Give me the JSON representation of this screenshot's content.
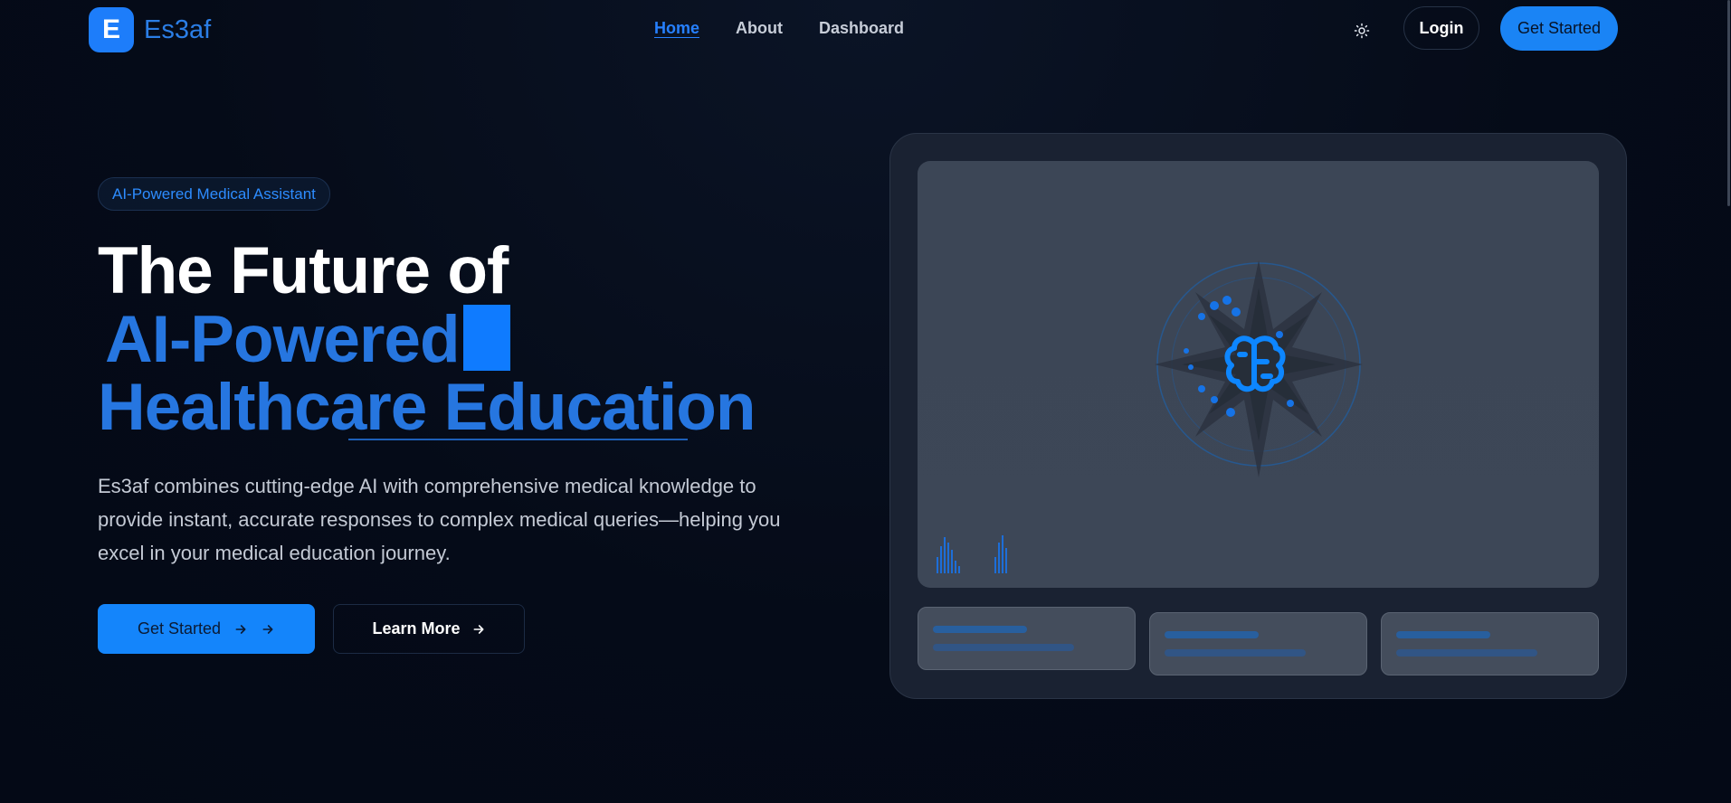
{
  "nav": {
    "logo_letter": "E",
    "brand": "Es3af",
    "links": [
      "Home",
      "About",
      "Dashboard"
    ],
    "active_link": "Home",
    "login": "Login",
    "get_started": "Get Started"
  },
  "hero": {
    "badge": "AI-Powered Medical Assistant",
    "title_line1": "The Future of",
    "title_line2": "AI-Powered",
    "title_line3": "Healthcare Education",
    "description": "Es3af combines cutting-edge AI with comprehensive medical knowledge to provide instant, accurate responses to complex medical queries—helping you excel in your medical education journey.",
    "primary_button": "Get Started",
    "secondary_button": "Learn More"
  },
  "colors": {
    "background": "#050b18",
    "accent": "#1a84f5",
    "heading_blue": "#2676e0"
  },
  "icons": {
    "theme_toggle": "sun-icon",
    "button_arrow": "arrow-right-icon",
    "illustration": "brain-icon"
  }
}
